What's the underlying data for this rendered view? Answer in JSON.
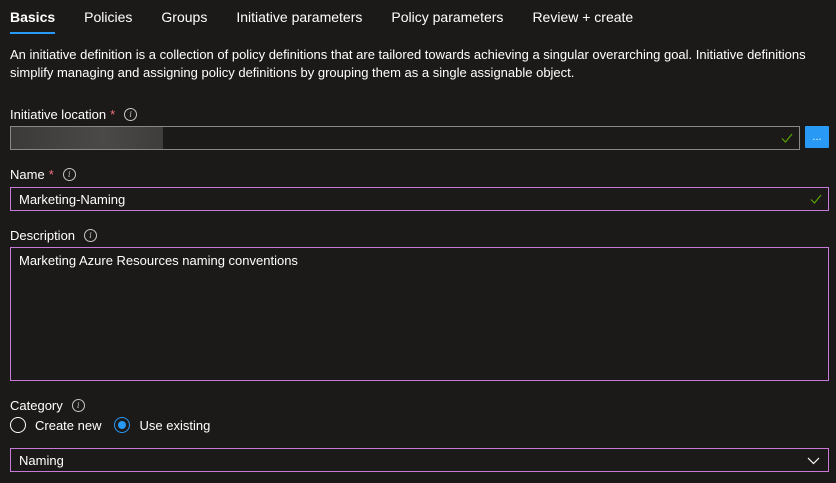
{
  "tabs": [
    {
      "label": "Basics",
      "active": true
    },
    {
      "label": "Policies",
      "active": false
    },
    {
      "label": "Groups",
      "active": false
    },
    {
      "label": "Initiative parameters",
      "active": false
    },
    {
      "label": "Policy parameters",
      "active": false
    },
    {
      "label": "Review + create",
      "active": false
    }
  ],
  "intro": "An initiative definition is a collection of policy definitions that are tailored towards achieving a singular overarching goal. Initiative definitions simplify managing and assigning policy definitions by grouping them as a single assignable object.",
  "location": {
    "label": "Initiative location",
    "required_mark": "*",
    "browse_label": "..."
  },
  "name": {
    "label": "Name",
    "required_mark": "*",
    "value": "Marketing-Naming"
  },
  "description": {
    "label": "Description",
    "value": "Marketing Azure Resources naming conventions"
  },
  "category": {
    "label": "Category",
    "options": [
      {
        "label": "Create new",
        "checked": false
      },
      {
        "label": "Use existing",
        "checked": true
      }
    ],
    "selected": "Naming"
  },
  "colors": {
    "background": "#1b1a19",
    "accent": "#2899f5",
    "focus_border": "#c87ad8",
    "required": "#f1707b",
    "valid": "#57a300"
  },
  "icons": {
    "info": "info-icon",
    "check": "checkmark-icon",
    "dropdown": "chevron-down-icon"
  }
}
